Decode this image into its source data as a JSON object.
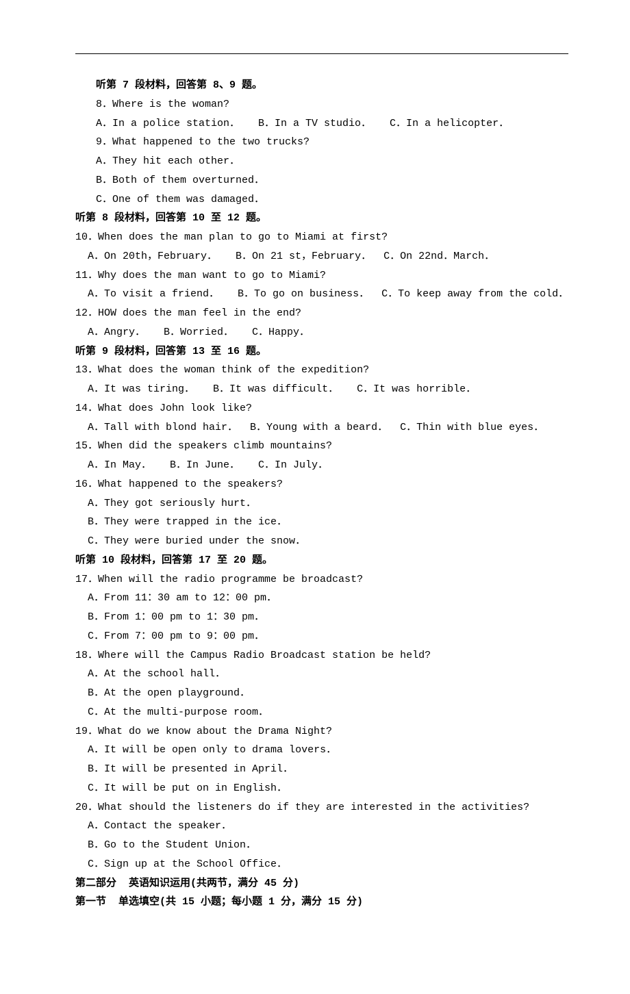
{
  "section7": {
    "header": "听第 7 段材料，回答第 8、9 题。",
    "q8": {
      "text": "8．Where is the woman?",
      "opts": "A．In a police station．   B．In a TV studio．   C．In a helicopter．"
    },
    "q9": {
      "text": "9．What happened to the two trucks?",
      "opts": {
        "a": "A．They hit each other．",
        "b": "B．Both of them overturned．",
        "c": "C．One of them was damaged．"
      }
    }
  },
  "section8": {
    "header": "听第 8 段材料，回答第 10 至 12 题。",
    "q10": {
      "text": "10．When does the man plan to go to Miami at first?",
      "opts": "A．On 20th，February．   B．On 21 st，February．  C．On 22nd．March．"
    },
    "q11": {
      "text": "11．Why does the man want to go to Miami?",
      "opts": "A．To visit a friend．   B．To go on business．  C．To keep away from the cold．"
    },
    "q12": {
      "text": "12．HOW does the man feel in the end?",
      "opts": "A．Angry．   B．Worried．   C．Happy．"
    }
  },
  "section9": {
    "header": "听第 9 段材料，回答第 13 至 16 题。",
    "q13": {
      "text": "13．What does the woman think of the expedition?",
      "opts": "A．It was tiring．   B．It was difficult．   C．It was horrible．"
    },
    "q14": {
      "text": "14．What does John look like?",
      "opts": "A．Tall with blond hair．  B．Young with a beard．  C．Thin with blue eyes．"
    },
    "q15": {
      "text": "15．When did the speakers climb mountains?",
      "opts": "A．In May．   B．In June．   C．In July．"
    },
    "q16": {
      "text": "16．What happened to the speakers?",
      "opts": {
        "a": "A．They got seriously hurt．",
        "b": "B．They were trapped in the ice．",
        "c": "C．They were buried under the snow．"
      }
    }
  },
  "section10": {
    "header": "听第 10 段材料，回答第 17 至 20 题。",
    "q17": {
      "text": "17．When will the radio programme be broadcast?",
      "opts": {
        "a": "A．From 11：30 am to 12：00 pm．",
        "b": "B．From 1：00 pm to 1：30 pm．",
        "c": "C．From 7：00 pm to 9：00 pm．"
      }
    },
    "q18": {
      "text": "18．Where will the Campus Radio Broadcast station be held?",
      "opts": {
        "a": "A．At the school hall．",
        "b": "B．At the open playground．",
        "c": "C．At the multi-purpose room．"
      }
    },
    "q19": {
      "text": "19．What do we know about the Drama Night?",
      "opts": {
        "a": "A．It will be open only to drama lovers．",
        "b": "B．It will be presented in April．",
        "c": "C．It will be put on in English．"
      }
    },
    "q20": {
      "text": "20．What should the listeners do if they are interested in the activities?",
      "opts": {
        "a": "A．Contact the speaker．",
        "b": "B．Go to the Student Union．",
        "c": "C．Sign up at the School Office．"
      }
    }
  },
  "part2": {
    "header": "第二部分  英语知识运用(共两节，满分 45 分)",
    "section1": "第一节  单选填空(共 15 小题；每小题 1 分，满分 15 分)"
  }
}
